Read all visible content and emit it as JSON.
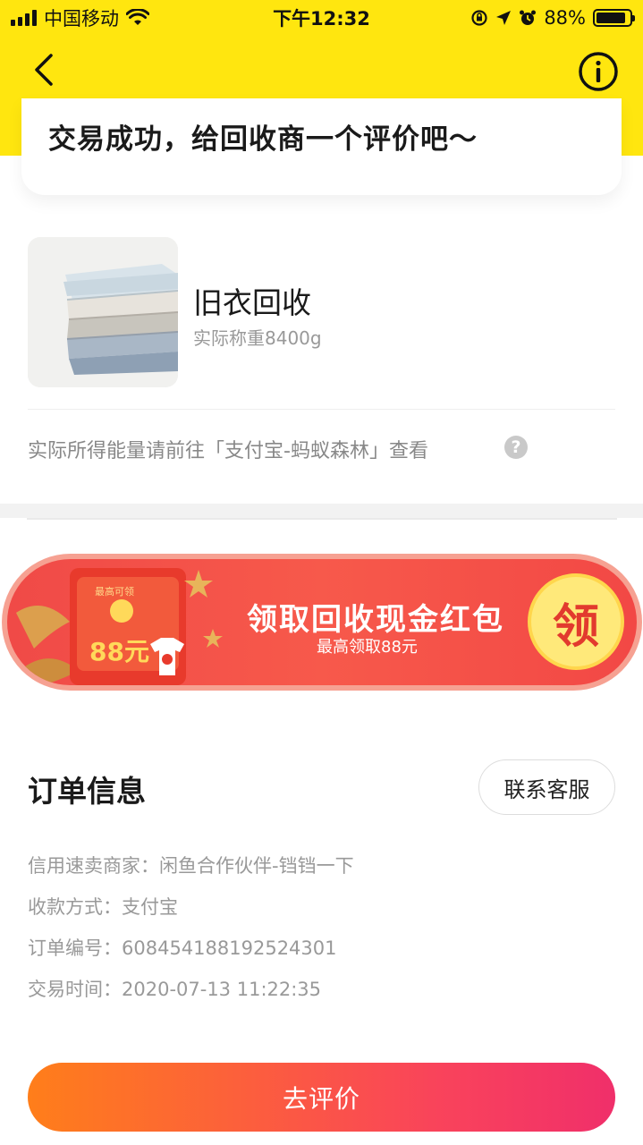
{
  "status_bar": {
    "carrier": "中国移动",
    "time": "下午12:32",
    "battery_percent": "88%",
    "battery_level": 0.88
  },
  "nav": {
    "back_icon": "chevron-left-icon",
    "info_icon": "info-circle-icon"
  },
  "header": {
    "title": "交易成功，给回收商一个评价吧～"
  },
  "product": {
    "name": "旧衣回收",
    "weight": "实际称重8400g",
    "energy_note": "实际所得能量请前往「支付宝-蚂蚁森林」查看",
    "help_glyph": "?"
  },
  "banner": {
    "envelope_top_text": "最高可领",
    "envelope_amount": "88元",
    "title": "领取回收现金红包",
    "subtitle": "最高领取88元",
    "claim_label": "领"
  },
  "order": {
    "title": "订单信息",
    "contact_button": "联系客服",
    "rows": [
      {
        "label": "信用速卖商家：",
        "value": "闲鱼合作伙伴-铛铛一下"
      },
      {
        "label": "收款方式：",
        "value": "支付宝"
      },
      {
        "label": "订单编号：",
        "value": "608454188192524301"
      },
      {
        "label": "交易时间：",
        "value": "2020-07-13 11:22:35"
      }
    ]
  },
  "actions": {
    "review_button": "去评价"
  },
  "colors": {
    "brand_yellow": "#ffe60f",
    "banner_red": "#f04a47",
    "gradient_start": "#ff7e1a",
    "gradient_end": "#f02f6a"
  }
}
